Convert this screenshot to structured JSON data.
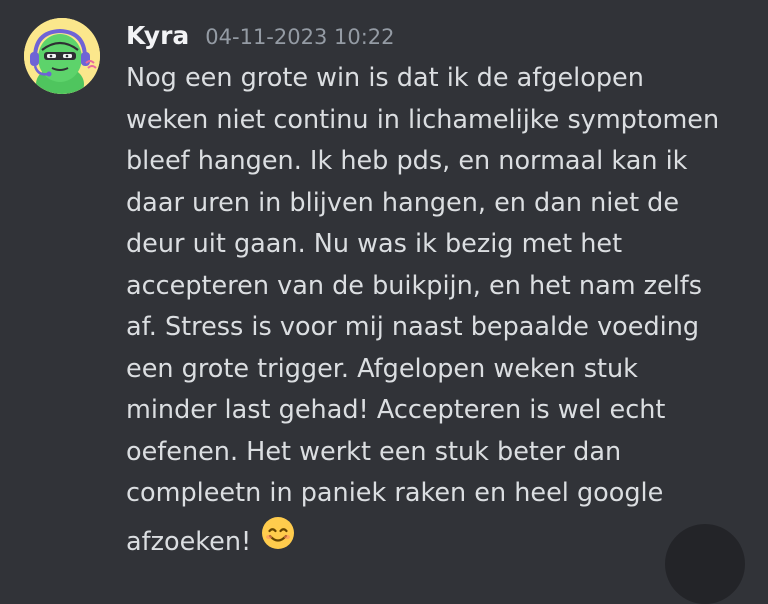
{
  "message": {
    "author": "Kyra",
    "timestamp": "04-11-2023 10:22",
    "lines": [
      "Nog een grote win is dat ik de afgelopen",
      "weken niet continu in lichamelijke symptomen",
      "bleef hangen. Ik heb pds, en normaal kan ik",
      "daar uren in blijven hangen, en dan niet de",
      "deur uit gaan. Nu was ik bezig met het",
      "accepteren van de buikpijn, en het nam zelfs",
      "af. Stress is voor mij naast bepaalde voeding",
      "een grote trigger. Afgelopen weken stuk",
      "minder last gehad! Accepteren is wel echt",
      "oefenen. Het werkt een stuk beter dan",
      "compleetn in paniek raken en heel google",
      "afzoeken!"
    ],
    "emoji": "smiling-face-with-smiling-eyes"
  },
  "colors": {
    "background": "#313338",
    "author": "#f2f3f5",
    "timestamp": "#949ba4",
    "text": "#dbdee1",
    "avatar_background": "#fbe78c",
    "avatar_character": "#5dd36b",
    "headset": "#6f63d6"
  },
  "icons": {
    "avatar": "green-character-with-headset-avatar",
    "corner": "round-action-button"
  }
}
